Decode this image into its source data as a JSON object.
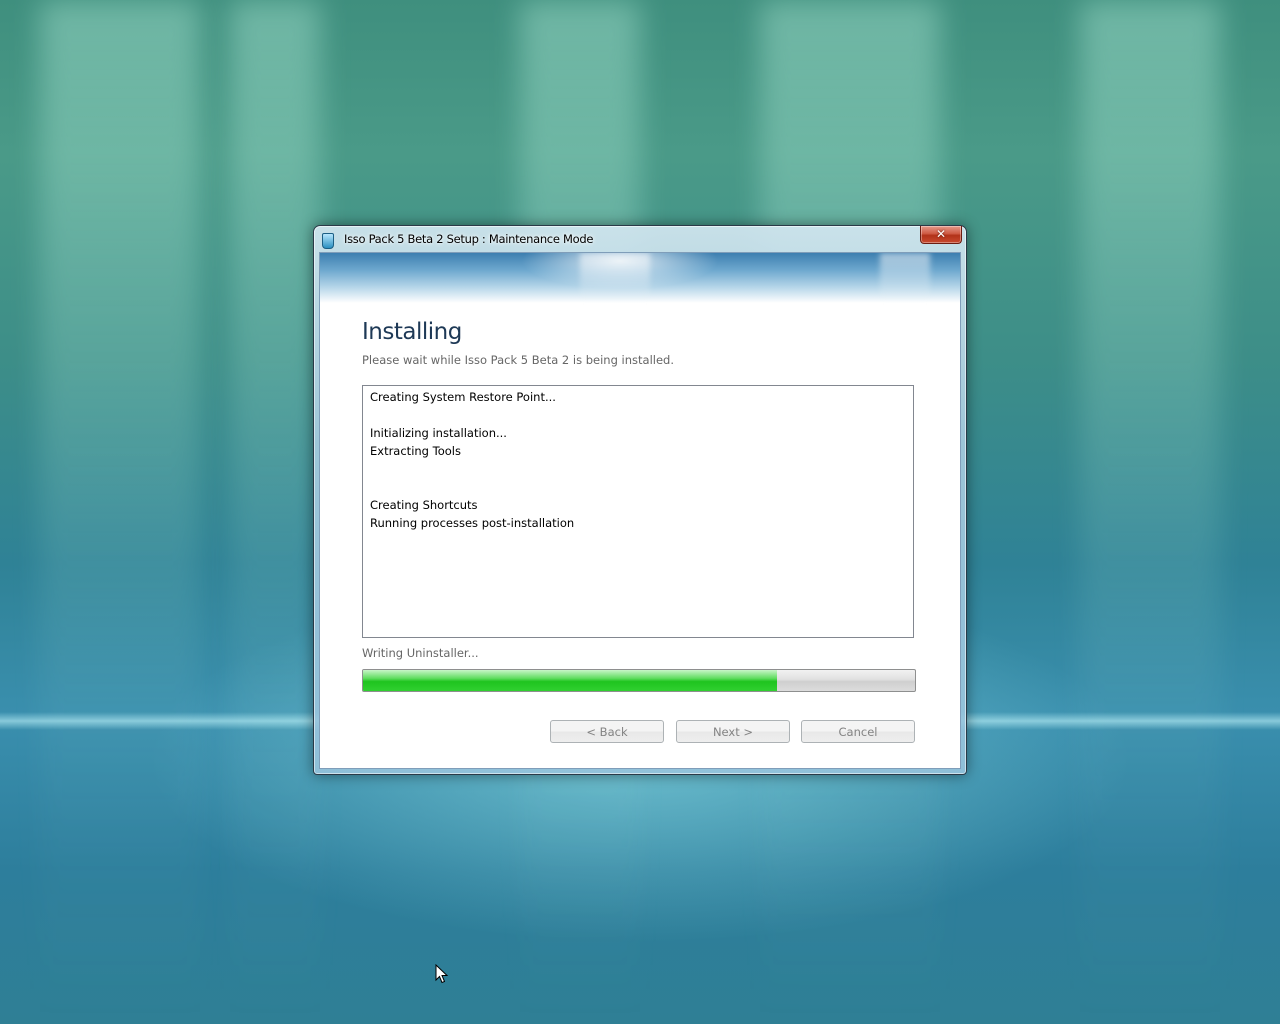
{
  "window": {
    "title": "Isso Pack 5 Beta 2 Setup : Maintenance Mode",
    "close_label": "✕"
  },
  "page": {
    "heading": "Installing",
    "subheading": "Please wait while Isso Pack 5 Beta 2 is being installed."
  },
  "log": {
    "lines": [
      "Creating System Restore Point...",
      "",
      "Initializing installation...",
      "Extracting Tools",
      "",
      "",
      "Creating Shortcuts",
      "Running processes post-installation"
    ]
  },
  "status": {
    "text": "Writing Uninstaller...",
    "progress_percent": 75
  },
  "buttons": {
    "back": "< Back",
    "next": "Next >",
    "cancel": "Cancel"
  },
  "colors": {
    "progress_fill": "#1fc41f",
    "heading": "#1e3956",
    "close_button": "#c94a30"
  }
}
